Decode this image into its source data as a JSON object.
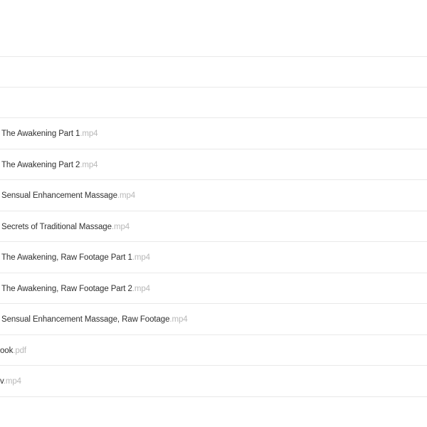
{
  "colors": {
    "divider": "#e9e9e9",
    "file_name_text": "#303030",
    "extension_text": "#b8b8b8",
    "background": "#ffffff"
  },
  "file_list": {
    "rows": [
      {
        "name": "The Awakening Part 1",
        "ext": ".mp4"
      },
      {
        "name": "The Awakening Part 2",
        "ext": ".mp4"
      },
      {
        "name": "Sensual Enhancement Massage",
        "ext": ".mp4"
      },
      {
        "name": "Secrets of Traditional Massage",
        "ext": ".mp4"
      },
      {
        "name": "The Awakening, Raw Footage Part 1",
        "ext": ".mp4"
      },
      {
        "name": "The Awakening, Raw Footage Part 2",
        "ext": ".mp4"
      },
      {
        "name": "Sensual Enhancement Massage, Raw Footage",
        "ext": ".mp4"
      },
      {
        "name": "ook",
        "ext": ".pdf"
      },
      {
        "name": "v",
        "ext": ".mp4"
      }
    ]
  }
}
